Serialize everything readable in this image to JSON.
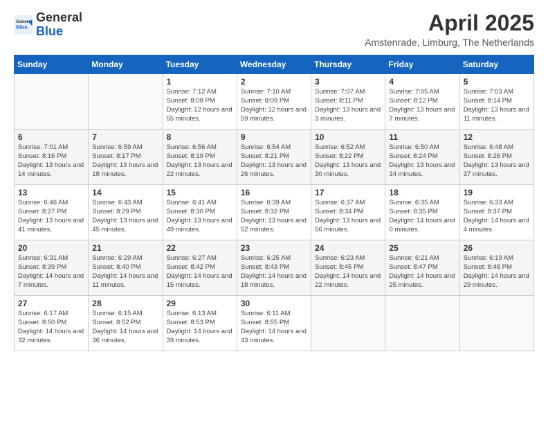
{
  "logo": {
    "general": "General",
    "blue": "Blue"
  },
  "header": {
    "month": "April 2025",
    "location": "Amstenrade, Limburg, The Netherlands"
  },
  "weekdays": [
    "Sunday",
    "Monday",
    "Tuesday",
    "Wednesday",
    "Thursday",
    "Friday",
    "Saturday"
  ],
  "weeks": [
    [
      {
        "day": "",
        "info": ""
      },
      {
        "day": "",
        "info": ""
      },
      {
        "day": "1",
        "info": "Sunrise: 7:12 AM\nSunset: 8:08 PM\nDaylight: 12 hours and 55 minutes."
      },
      {
        "day": "2",
        "info": "Sunrise: 7:10 AM\nSunset: 8:09 PM\nDaylight: 12 hours and 59 minutes."
      },
      {
        "day": "3",
        "info": "Sunrise: 7:07 AM\nSunset: 8:11 PM\nDaylight: 13 hours and 3 minutes."
      },
      {
        "day": "4",
        "info": "Sunrise: 7:05 AM\nSunset: 8:12 PM\nDaylight: 13 hours and 7 minutes."
      },
      {
        "day": "5",
        "info": "Sunrise: 7:03 AM\nSunset: 8:14 PM\nDaylight: 13 hours and 11 minutes."
      }
    ],
    [
      {
        "day": "6",
        "info": "Sunrise: 7:01 AM\nSunset: 8:16 PM\nDaylight: 13 hours and 14 minutes."
      },
      {
        "day": "7",
        "info": "Sunrise: 6:59 AM\nSunset: 8:17 PM\nDaylight: 13 hours and 18 minutes."
      },
      {
        "day": "8",
        "info": "Sunrise: 6:56 AM\nSunset: 8:19 PM\nDaylight: 13 hours and 22 minutes."
      },
      {
        "day": "9",
        "info": "Sunrise: 6:54 AM\nSunset: 8:21 PM\nDaylight: 13 hours and 26 minutes."
      },
      {
        "day": "10",
        "info": "Sunrise: 6:52 AM\nSunset: 8:22 PM\nDaylight: 13 hours and 30 minutes."
      },
      {
        "day": "11",
        "info": "Sunrise: 6:50 AM\nSunset: 8:24 PM\nDaylight: 13 hours and 34 minutes."
      },
      {
        "day": "12",
        "info": "Sunrise: 6:48 AM\nSunset: 8:26 PM\nDaylight: 13 hours and 37 minutes."
      }
    ],
    [
      {
        "day": "13",
        "info": "Sunrise: 6:46 AM\nSunset: 8:27 PM\nDaylight: 13 hours and 41 minutes."
      },
      {
        "day": "14",
        "info": "Sunrise: 6:43 AM\nSunset: 8:29 PM\nDaylight: 13 hours and 45 minutes."
      },
      {
        "day": "15",
        "info": "Sunrise: 6:41 AM\nSunset: 8:30 PM\nDaylight: 13 hours and 49 minutes."
      },
      {
        "day": "16",
        "info": "Sunrise: 6:39 AM\nSunset: 8:32 PM\nDaylight: 13 hours and 52 minutes."
      },
      {
        "day": "17",
        "info": "Sunrise: 6:37 AM\nSunset: 8:34 PM\nDaylight: 13 hours and 56 minutes."
      },
      {
        "day": "18",
        "info": "Sunrise: 6:35 AM\nSunset: 8:35 PM\nDaylight: 14 hours and 0 minutes."
      },
      {
        "day": "19",
        "info": "Sunrise: 6:33 AM\nSunset: 8:37 PM\nDaylight: 14 hours and 4 minutes."
      }
    ],
    [
      {
        "day": "20",
        "info": "Sunrise: 6:31 AM\nSunset: 8:39 PM\nDaylight: 14 hours and 7 minutes."
      },
      {
        "day": "21",
        "info": "Sunrise: 6:29 AM\nSunset: 8:40 PM\nDaylight: 14 hours and 11 minutes."
      },
      {
        "day": "22",
        "info": "Sunrise: 6:27 AM\nSunset: 8:42 PM\nDaylight: 14 hours and 15 minutes."
      },
      {
        "day": "23",
        "info": "Sunrise: 6:25 AM\nSunset: 8:43 PM\nDaylight: 14 hours and 18 minutes."
      },
      {
        "day": "24",
        "info": "Sunrise: 6:23 AM\nSunset: 8:45 PM\nDaylight: 14 hours and 22 minutes."
      },
      {
        "day": "25",
        "info": "Sunrise: 6:21 AM\nSunset: 8:47 PM\nDaylight: 14 hours and 25 minutes."
      },
      {
        "day": "26",
        "info": "Sunrise: 6:19 AM\nSunset: 8:48 PM\nDaylight: 14 hours and 29 minutes."
      }
    ],
    [
      {
        "day": "27",
        "info": "Sunrise: 6:17 AM\nSunset: 8:50 PM\nDaylight: 14 hours and 32 minutes."
      },
      {
        "day": "28",
        "info": "Sunrise: 6:15 AM\nSunset: 8:52 PM\nDaylight: 14 hours and 36 minutes."
      },
      {
        "day": "29",
        "info": "Sunrise: 6:13 AM\nSunset: 8:53 PM\nDaylight: 14 hours and 39 minutes."
      },
      {
        "day": "30",
        "info": "Sunrise: 6:11 AM\nSunset: 8:55 PM\nDaylight: 14 hours and 43 minutes."
      },
      {
        "day": "",
        "info": ""
      },
      {
        "day": "",
        "info": ""
      },
      {
        "day": "",
        "info": ""
      }
    ]
  ]
}
